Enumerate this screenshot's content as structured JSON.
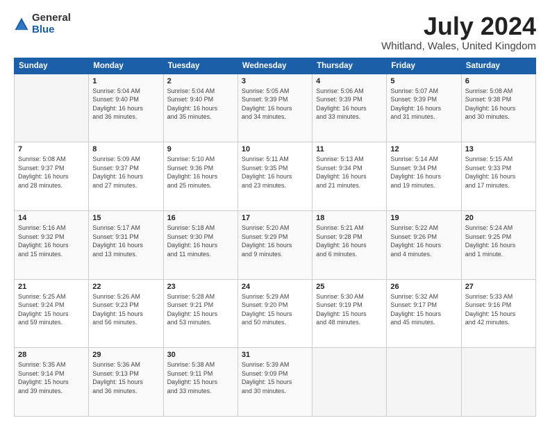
{
  "header": {
    "logo_general": "General",
    "logo_blue": "Blue",
    "month_title": "July 2024",
    "location": "Whitland, Wales, United Kingdom"
  },
  "days_of_week": [
    "Sunday",
    "Monday",
    "Tuesday",
    "Wednesday",
    "Thursday",
    "Friday",
    "Saturday"
  ],
  "weeks": [
    [
      {
        "day": "",
        "info": ""
      },
      {
        "day": "1",
        "info": "Sunrise: 5:04 AM\nSunset: 9:40 PM\nDaylight: 16 hours\nand 36 minutes."
      },
      {
        "day": "2",
        "info": "Sunrise: 5:04 AM\nSunset: 9:40 PM\nDaylight: 16 hours\nand 35 minutes."
      },
      {
        "day": "3",
        "info": "Sunrise: 5:05 AM\nSunset: 9:39 PM\nDaylight: 16 hours\nand 34 minutes."
      },
      {
        "day": "4",
        "info": "Sunrise: 5:06 AM\nSunset: 9:39 PM\nDaylight: 16 hours\nand 33 minutes."
      },
      {
        "day": "5",
        "info": "Sunrise: 5:07 AM\nSunset: 9:39 PM\nDaylight: 16 hours\nand 31 minutes."
      },
      {
        "day": "6",
        "info": "Sunrise: 5:08 AM\nSunset: 9:38 PM\nDaylight: 16 hours\nand 30 minutes."
      }
    ],
    [
      {
        "day": "7",
        "info": "Sunrise: 5:08 AM\nSunset: 9:37 PM\nDaylight: 16 hours\nand 28 minutes."
      },
      {
        "day": "8",
        "info": "Sunrise: 5:09 AM\nSunset: 9:37 PM\nDaylight: 16 hours\nand 27 minutes."
      },
      {
        "day": "9",
        "info": "Sunrise: 5:10 AM\nSunset: 9:36 PM\nDaylight: 16 hours\nand 25 minutes."
      },
      {
        "day": "10",
        "info": "Sunrise: 5:11 AM\nSunset: 9:35 PM\nDaylight: 16 hours\nand 23 minutes."
      },
      {
        "day": "11",
        "info": "Sunrise: 5:13 AM\nSunset: 9:34 PM\nDaylight: 16 hours\nand 21 minutes."
      },
      {
        "day": "12",
        "info": "Sunrise: 5:14 AM\nSunset: 9:34 PM\nDaylight: 16 hours\nand 19 minutes."
      },
      {
        "day": "13",
        "info": "Sunrise: 5:15 AM\nSunset: 9:33 PM\nDaylight: 16 hours\nand 17 minutes."
      }
    ],
    [
      {
        "day": "14",
        "info": "Sunrise: 5:16 AM\nSunset: 9:32 PM\nDaylight: 16 hours\nand 15 minutes."
      },
      {
        "day": "15",
        "info": "Sunrise: 5:17 AM\nSunset: 9:31 PM\nDaylight: 16 hours\nand 13 minutes."
      },
      {
        "day": "16",
        "info": "Sunrise: 5:18 AM\nSunset: 9:30 PM\nDaylight: 16 hours\nand 11 minutes."
      },
      {
        "day": "17",
        "info": "Sunrise: 5:20 AM\nSunset: 9:29 PM\nDaylight: 16 hours\nand 9 minutes."
      },
      {
        "day": "18",
        "info": "Sunrise: 5:21 AM\nSunset: 9:28 PM\nDaylight: 16 hours\nand 6 minutes."
      },
      {
        "day": "19",
        "info": "Sunrise: 5:22 AM\nSunset: 9:26 PM\nDaylight: 16 hours\nand 4 minutes."
      },
      {
        "day": "20",
        "info": "Sunrise: 5:24 AM\nSunset: 9:25 PM\nDaylight: 16 hours\nand 1 minute."
      }
    ],
    [
      {
        "day": "21",
        "info": "Sunrise: 5:25 AM\nSunset: 9:24 PM\nDaylight: 15 hours\nand 59 minutes."
      },
      {
        "day": "22",
        "info": "Sunrise: 5:26 AM\nSunset: 9:23 PM\nDaylight: 15 hours\nand 56 minutes."
      },
      {
        "day": "23",
        "info": "Sunrise: 5:28 AM\nSunset: 9:21 PM\nDaylight: 15 hours\nand 53 minutes."
      },
      {
        "day": "24",
        "info": "Sunrise: 5:29 AM\nSunset: 9:20 PM\nDaylight: 15 hours\nand 50 minutes."
      },
      {
        "day": "25",
        "info": "Sunrise: 5:30 AM\nSunset: 9:19 PM\nDaylight: 15 hours\nand 48 minutes."
      },
      {
        "day": "26",
        "info": "Sunrise: 5:32 AM\nSunset: 9:17 PM\nDaylight: 15 hours\nand 45 minutes."
      },
      {
        "day": "27",
        "info": "Sunrise: 5:33 AM\nSunset: 9:16 PM\nDaylight: 15 hours\nand 42 minutes."
      }
    ],
    [
      {
        "day": "28",
        "info": "Sunrise: 5:35 AM\nSunset: 9:14 PM\nDaylight: 15 hours\nand 39 minutes."
      },
      {
        "day": "29",
        "info": "Sunrise: 5:36 AM\nSunset: 9:13 PM\nDaylight: 15 hours\nand 36 minutes."
      },
      {
        "day": "30",
        "info": "Sunrise: 5:38 AM\nSunset: 9:11 PM\nDaylight: 15 hours\nand 33 minutes."
      },
      {
        "day": "31",
        "info": "Sunrise: 5:39 AM\nSunset: 9:09 PM\nDaylight: 15 hours\nand 30 minutes."
      },
      {
        "day": "",
        "info": ""
      },
      {
        "day": "",
        "info": ""
      },
      {
        "day": "",
        "info": ""
      }
    ]
  ]
}
